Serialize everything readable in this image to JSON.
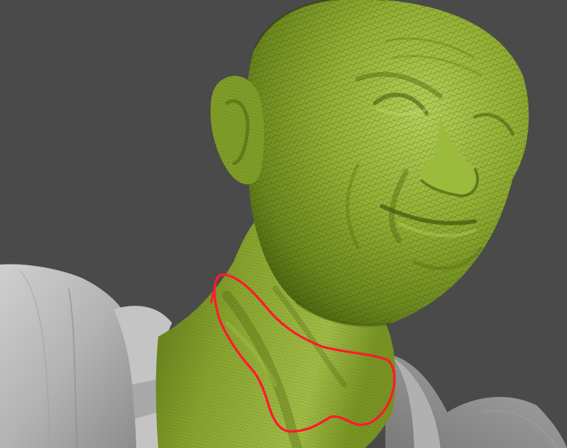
{
  "scene": {
    "subject": "sculpt-render",
    "background_color": "#4b4b4b",
    "skin_color": "#8fae2e",
    "skin_highlight": "#b5cf55",
    "skin_shadow": "#4f6a12",
    "wire_color": "#2e3a0c",
    "cloth_color": "#b9b9b9",
    "cloth_shadow": "#7d7d7d",
    "annotation_color": "#ff1a2e"
  },
  "icons": {
    "annotation": "freehand-loop"
  }
}
